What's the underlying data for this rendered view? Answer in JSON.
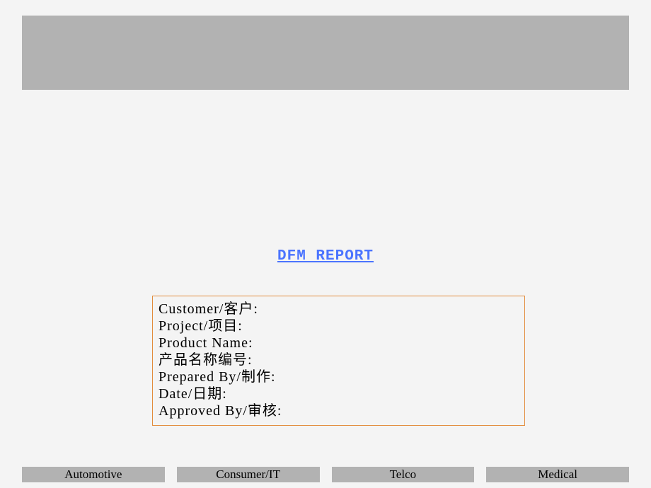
{
  "title": "DFM REPORT",
  "info": {
    "customer_label": "Customer/客户:",
    "project_label": "Project/项目:",
    "product_name_label": "Product Name:",
    "product_code_label": "产品名称编号:",
    "prepared_by_label": "Prepared By/制作:",
    "date_label": "Date/日期:",
    "approved_by_label": "Approved By/审核:"
  },
  "tabs": {
    "t0": "Automotive",
    "t1": "Consumer/IT",
    "t2": "Telco",
    "t3": "Medical"
  }
}
